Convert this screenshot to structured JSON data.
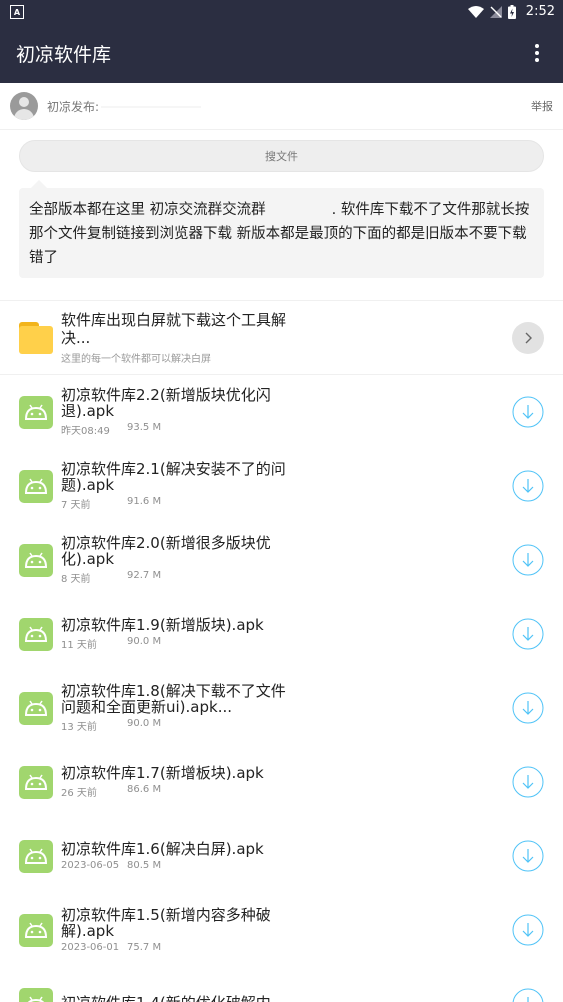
{
  "status": {
    "time": "2:52",
    "app_icon": "A"
  },
  "appbar": {
    "title": "初凉软件库",
    "menu_icon": "more-vert-icon"
  },
  "poster": {
    "name": "初凉发布:",
    "report": "举报"
  },
  "search": {
    "label": "搜文件"
  },
  "notice": {
    "part1": "全部版本都在这里 初凉交流群交流群",
    "part2": ". 软件库下载不了文件那就长按那个文件复制链接到浏览器下载 新版本都是最顶的下面的都是旧版本不要下载错了"
  },
  "folder": {
    "title": "软件库出现白屏就下载这个工具解决...",
    "subtitle": "这里的每一个软件都可以解决白屏"
  },
  "files": [
    {
      "title": "初凉软件库2.2(新增版块优化闪退).apk",
      "date": "昨天08:49",
      "size": "93.5 M"
    },
    {
      "title": "初凉软件库2.1(解决安装不了的问题).apk",
      "date": "7 天前",
      "size": "91.6 M"
    },
    {
      "title": "初凉软件库2.0(新增很多版块优化).apk",
      "date": "8 天前",
      "size": "92.7 M"
    },
    {
      "title": "初凉软件库1.9(新增版块).apk",
      "date": "11 天前",
      "size": "90.0 M"
    },
    {
      "title": "初凉软件库1.8(解决下载不了文件问题和全面更新ui).apk...",
      "date": "13 天前",
      "size": "90.0 M"
    },
    {
      "title": "初凉软件库1.7(新增板块).apk",
      "date": "26 天前",
      "size": "86.6 M"
    },
    {
      "title": "初凉软件库1.6(解决白屏).apk",
      "date": "2023-06-05",
      "size": "80.5 M"
    },
    {
      "title": "初凉软件库1.5(新增内容多种破解).apk",
      "date": "2023-06-01",
      "size": "75.7 M"
    },
    {
      "title": "初凉软件库1.4(新的优化破解内",
      "date": "",
      "size": ""
    }
  ],
  "colors": {
    "bar": "#2b2e41",
    "apk": "#a1d66e",
    "download": "#4fc3f7"
  }
}
